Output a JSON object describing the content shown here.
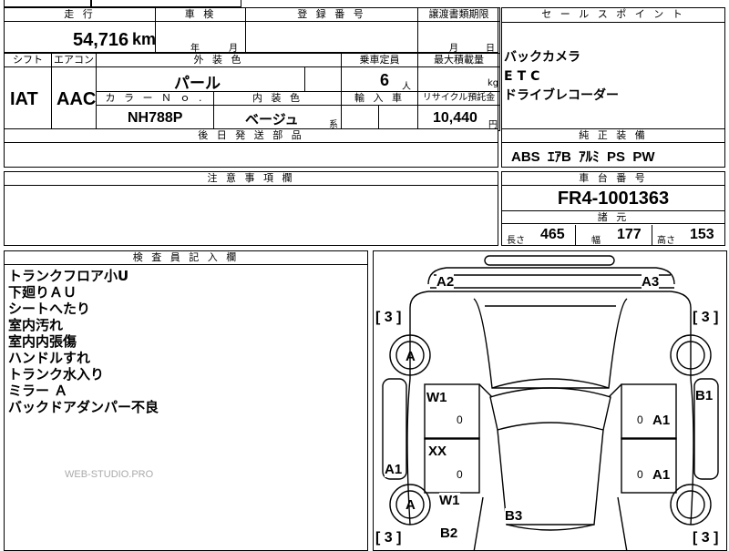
{
  "top_row": {
    "mileage_label": "走 行",
    "inspection_label": "車 検",
    "registration_label": "登 録 番 号",
    "transfer_doc_label": "譲渡書類期限",
    "mileage_value": "54,716",
    "mileage_unit": "km",
    "inspection_year_unit": "年",
    "inspection_month_unit": "月",
    "transfer_month_unit": "月",
    "transfer_day_unit": "日"
  },
  "sales_points": {
    "label": "セ ー ル ス ポ イ ン ト",
    "items": [
      "バックカメラ",
      "ETC",
      "ドライブレコーダー"
    ]
  },
  "spec_row": {
    "shift_label": "シフト",
    "aircon_label": "エアコン",
    "exterior_color_label": "外 装 色",
    "capacity_label": "乗車定員",
    "max_load_label": "最大積載量",
    "shift_value": "IAT",
    "aircon_value": "AAC",
    "exterior_color_value": "パール",
    "capacity_value": "6",
    "capacity_unit": "人",
    "max_load_unit": "kg",
    "color_no_label": "カ ラ ー Ｎ ｏ .",
    "interior_color_label": "内 装 色",
    "import_label": "輸 入 車",
    "recycle_label": "リサイクル預託金",
    "color_no_value": "NH788P",
    "interior_color_value": "ベージュ",
    "interior_color_suffix": "系",
    "recycle_value": "10,440",
    "recycle_unit": "円"
  },
  "later_parts": {
    "label": "後 日 発 送 部 品"
  },
  "genuine_equipment": {
    "label": "純 正 装 備",
    "value": "ABS  ｴｱB  ｱﾙﾐ  PS  PW"
  },
  "caution": {
    "label": "注 意 事 項 欄"
  },
  "chassis": {
    "label": "車 台 番 号",
    "value": "FR4-1001363",
    "specs_label": "諸 元",
    "length_label": "長さ",
    "length_value": "465",
    "width_label": "幅",
    "width_value": "177",
    "height_label": "高さ",
    "height_value": "153"
  },
  "inspector_notes": {
    "label": "検 査 員 記 入 欄",
    "lines": [
      "トランクフロア小U",
      "下廻りＡＵ",
      "シートへたり",
      "室内汚れ",
      "室内内張傷",
      "ハンドルすれ",
      "トランク水入り",
      "ミラー Ａ",
      "バックドアダンパー不良"
    ],
    "watermark": "WEB-STUDIO.PRO"
  },
  "diagram": {
    "tire_depth_left_front": "[ 3 ]",
    "tire_depth_right_front": "[ 3 ]",
    "tire_depth_left_rear": "[ 3 ]",
    "tire_depth_right_rear": "[ 3 ]",
    "marks": {
      "front_left_corner": "A2",
      "front_right_corner": "A3",
      "front_left_wheel": "A",
      "rear_left_wheel": "A",
      "left_front_door": "W1",
      "left_rear_door": "XX",
      "left_rocker": "A1",
      "left_rear_quarter": "W1",
      "rear_left_corner": "B2",
      "rear_center": "B3",
      "right_front_door": "A1",
      "right_rear_door": "A1",
      "right_fender": "B1"
    },
    "zero_marks": [
      "0",
      "0",
      "0",
      "0"
    ]
  }
}
